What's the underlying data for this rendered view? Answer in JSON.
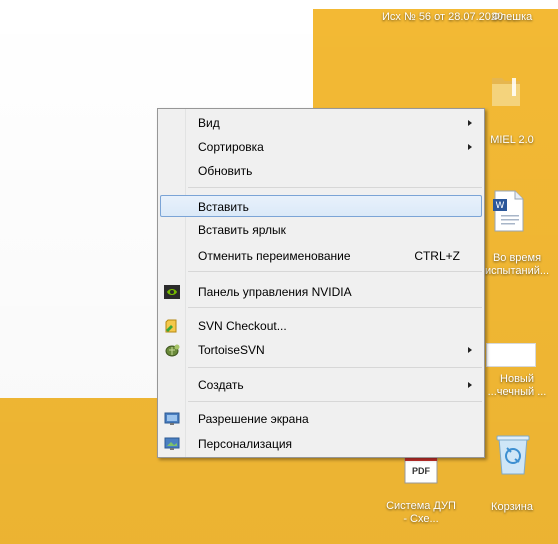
{
  "desktop": {
    "top_items": [
      {
        "label": "Исх № 56 от 28.07.2020 ..."
      },
      {
        "label": "Флешка"
      }
    ],
    "right_items": [
      {
        "label": "MIEL 2.0"
      },
      {
        "label": "Во время испытаний..."
      },
      {
        "label": "Новый ...чечный ..."
      },
      {
        "label": "Корзина"
      }
    ],
    "bottom_items": [
      {
        "label": "Система ДУП - Схе...",
        "badge": "PDF"
      }
    ]
  },
  "context_menu": {
    "items": [
      {
        "label": "Вид",
        "submenu": true
      },
      {
        "label": "Сортировка",
        "submenu": true
      },
      {
        "label": "Обновить"
      },
      {
        "label": "Вставить",
        "highlighted": true
      },
      {
        "label": "Вставить ярлык"
      },
      {
        "label": "Отменить переименование",
        "shortcut": "CTRL+Z"
      },
      {
        "label": "Панель управления NVIDIA",
        "icon": "nvidia-icon"
      },
      {
        "label": "SVN Checkout...",
        "icon": "svn-checkout-icon"
      },
      {
        "label": "TortoiseSVN",
        "icon": "tortoisesvn-icon",
        "submenu": true
      },
      {
        "label": "Создать",
        "submenu": true
      },
      {
        "label": "Разрешение экрана",
        "icon": "screen-resolution-icon"
      },
      {
        "label": "Персонализация",
        "icon": "personalization-icon"
      }
    ]
  }
}
